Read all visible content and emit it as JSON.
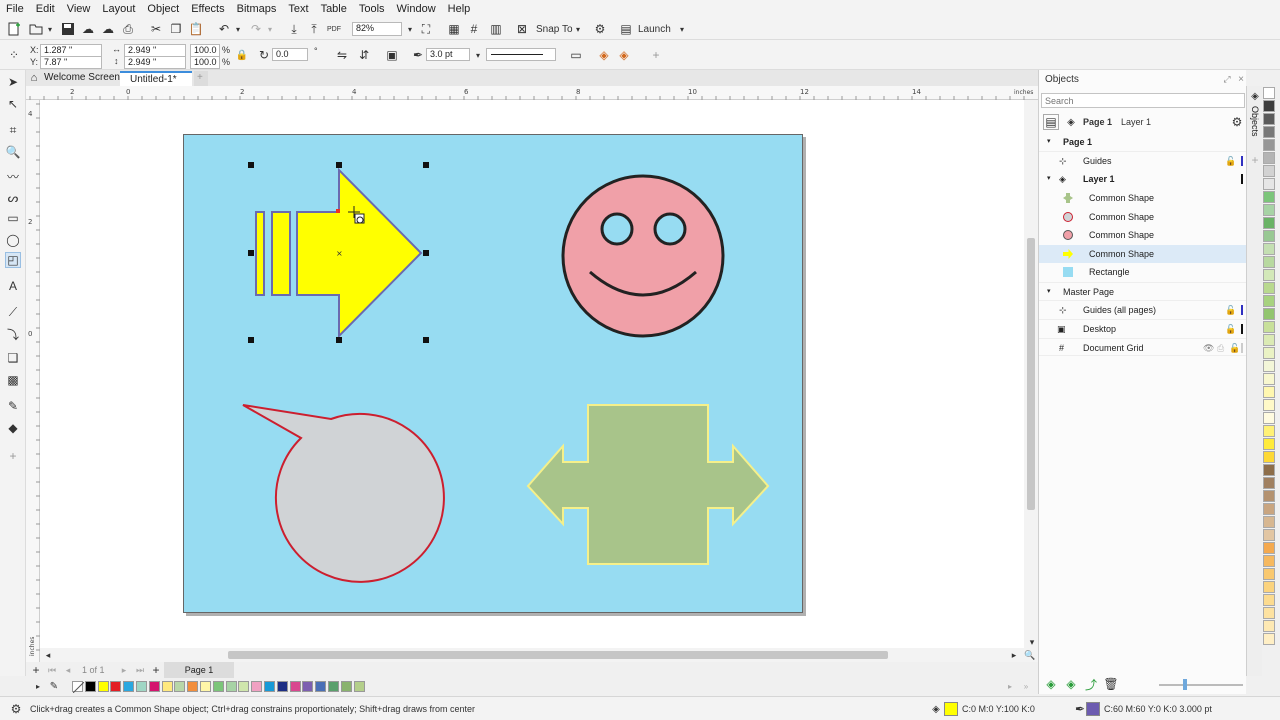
{
  "menu": [
    "File",
    "Edit",
    "View",
    "Layout",
    "Object",
    "Effects",
    "Bitmaps",
    "Text",
    "Table",
    "Tools",
    "Window",
    "Help"
  ],
  "toolbar": {
    "zoom": "82%",
    "snap_to": "Snap To",
    "launch": "Launch"
  },
  "property_bar": {
    "x_label": "X:",
    "x_value": "1.287 \"",
    "y_label": "Y:",
    "y_value": "7.87 \"",
    "width_value": "2.949 \"",
    "height_value": "2.949 \"",
    "scale_w": "100.0",
    "scale_h": "100.0",
    "percent_w": "%",
    "percent_h": "%",
    "angle": "0.0",
    "degree": "°",
    "outline_width": "3.0 pt"
  },
  "tabs": {
    "welcome": "Welcome Screen",
    "document": "Untitled-1*",
    "add": "+"
  },
  "ruler": {
    "h_ticks": [
      "2",
      "0",
      "2",
      "4",
      "6",
      "8",
      "10",
      "12",
      "14"
    ],
    "h_unit": "inches",
    "v_ticks": [
      "4",
      "2",
      "0"
    ],
    "v_unit": "inches"
  },
  "page_nav": {
    "count": "1 of 1",
    "page_tab": "Page 1"
  },
  "docker": {
    "title": "Objects",
    "search_placeholder": "Search",
    "breadcrumb_page": "Page 1",
    "breadcrumb_layer": "Layer 1",
    "tab_label": "Objects",
    "rows": {
      "page1": "Page 1",
      "guides": "Guides",
      "layer1": "Layer 1",
      "shape1": "Common Shape",
      "shape2": "Common Shape",
      "shape3": "Common Shape",
      "shape4": "Common Shape",
      "rectangle": "Rectangle",
      "master": "Master Page",
      "guides_all": "Guides (all pages)",
      "desktop": "Desktop",
      "grid": "Document Grid"
    }
  },
  "status": {
    "hint": "Click+drag creates a Common Shape object; Ctrl+drag constrains proportionately; Shift+drag draws from center",
    "fill_value": "C:0 M:0 Y:100 K:0",
    "outline_value": "C:60 M:60 Y:0 K:0  3.000 pt"
  },
  "colors": {
    "page_bg": "#97dcf2",
    "arrow_fill": "#ffff00",
    "arrow_stroke": "#6a6ab0",
    "face_fill": "#f0a0a8",
    "bubble_fill": "#d0d3d6",
    "bubble_stroke": "#cc1f2f",
    "cross_fill": "#a8c48a",
    "cross_stroke": "#f5f08a",
    "palette_bottom": [
      "#ffffff",
      "#000000",
      "#ffff00",
      "#e31e24",
      "#2aa8e0",
      "#9fd6c4",
      "#d4146e",
      "#ffe97f",
      "#b8d7a8",
      "#f28e3c",
      "#fff6a8",
      "#7cc57a",
      "#a7d3a5",
      "#cfe6ac",
      "#f0a1c2",
      "#179ad7",
      "#1d2e84",
      "#d9488f",
      "#7d5fb0",
      "#4a6fb6",
      "#5aa06c",
      "#8ab36e",
      "#b4cf8a"
    ],
    "palette_right": [
      "#ffffff",
      "#3c3c3c",
      "#5a5a5a",
      "#787878",
      "#969696",
      "#b4b4b4",
      "#d2d2d2",
      "#e6e6e6",
      "#7cc57a",
      "#a7d3a5",
      "#6ab366",
      "#98c893",
      "#c4dfb2",
      "#b8d9a0",
      "#d3e8b9",
      "#b9d98f",
      "#a7d27f",
      "#92c56f",
      "#c8e09a",
      "#dbeab4",
      "#eaf2c4",
      "#f3f6d8",
      "#f8f7cf",
      "#fff7b0",
      "#fff9c8",
      "#fffbe0",
      "#fff176",
      "#ffeb3b",
      "#fdd835",
      "#8d6e4a",
      "#a08060",
      "#b49270",
      "#c9a580",
      "#d7b791",
      "#e2c6a3",
      "#f4a94f",
      "#f6b85e",
      "#f9c86f",
      "#fbd37e",
      "#fcdb8f",
      "#fde2a1",
      "#fee9b3",
      "#ffefc5"
    ]
  }
}
